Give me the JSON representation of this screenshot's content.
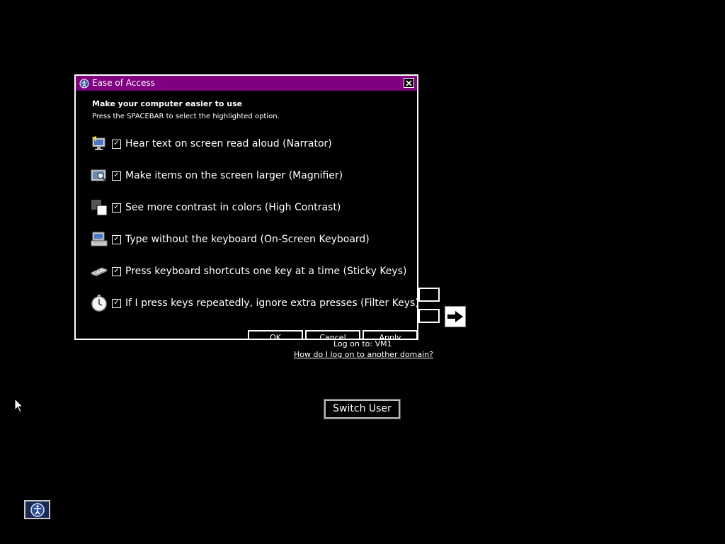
{
  "logon": {
    "log_on_to": "Log on to: VM1",
    "other_domain_link": "How do I log on to another domain?",
    "switch_user_label": "Switch User"
  },
  "dialog": {
    "title": "Ease of Access",
    "heading": "Make your computer easier to use",
    "subheading": "Press the SPACEBAR to select the highlighted option.",
    "options": [
      {
        "label": "Hear text on screen read aloud (Narrator)",
        "checked": true,
        "icon": "narrator-icon"
      },
      {
        "label": "Make items on the screen larger (Magnifier)",
        "checked": true,
        "icon": "magnifier-icon"
      },
      {
        "label": "See more contrast in colors (High Contrast)",
        "checked": true,
        "icon": "high-contrast-icon"
      },
      {
        "label": "Type without the keyboard (On-Screen Keyboard)",
        "checked": true,
        "icon": "on-screen-keyboard-icon"
      },
      {
        "label": "Press keyboard shortcuts one key at a time (Sticky Keys)",
        "checked": true,
        "icon": "sticky-keys-icon"
      },
      {
        "label": "If I press keys repeatedly, ignore extra presses (Filter Keys)",
        "checked": true,
        "icon": "filter-keys-icon"
      }
    ],
    "buttons": {
      "ok": "OK",
      "cancel": "Cancel",
      "apply": "Apply"
    },
    "colors": {
      "titlebar": "#800080",
      "background": "#000000",
      "foreground": "#ffffff"
    }
  }
}
